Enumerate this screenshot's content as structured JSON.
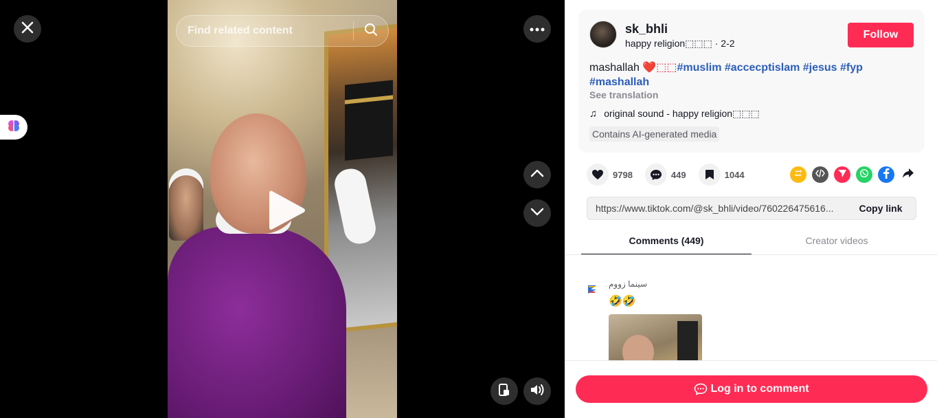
{
  "search": {
    "placeholder": "Find related content"
  },
  "author": {
    "username": "sk_bhli",
    "nickname": "happy religion⬚⬚⬚",
    "date": " · 2-2",
    "follow_label": "Follow"
  },
  "post": {
    "caption": "mashallah ",
    "caption_emoji": "❤️⬚⬚",
    "tags": [
      "#muslim",
      "#accecptislam",
      "#jesus",
      "#fyp",
      "#mashallah"
    ],
    "see_translation": "See translation",
    "sound": "original sound - happy religion⬚⬚⬚",
    "ai_badge": "Contains AI-generated media"
  },
  "stats": {
    "likes": "9798",
    "comments": "449",
    "saves": "1044"
  },
  "link": {
    "url": "https://www.tiktok.com/@sk_bhli/video/760226475616...",
    "copy_label": "Copy link"
  },
  "tabs": [
    {
      "label": "Comments (449)"
    },
    {
      "label": "Creator videos"
    }
  ],
  "comments": [
    {
      "username": "سينما زووم",
      "text": "🤣🤣"
    }
  ],
  "bottom": {
    "login_label": "Log in to comment"
  },
  "colors": {
    "accent": "#fe2c55",
    "hashtag": "#2b5db9"
  }
}
